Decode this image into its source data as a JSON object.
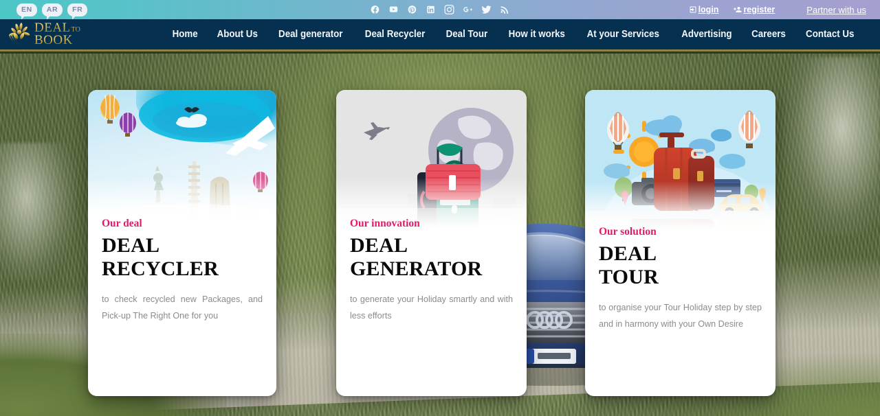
{
  "topbar": {
    "languages": [
      {
        "code": "EN",
        "name": "lang-en"
      },
      {
        "code": "AR",
        "name": "lang-ar"
      },
      {
        "code": "FR",
        "name": "lang-fr"
      }
    ],
    "social": [
      {
        "icon": "facebook-icon",
        "label": "Facebook"
      },
      {
        "icon": "youtube-icon",
        "label": "YouTube"
      },
      {
        "icon": "pinterest-icon",
        "label": "Pinterest"
      },
      {
        "icon": "linkedin-icon",
        "label": "LinkedIn"
      },
      {
        "icon": "instagram-icon",
        "label": "Instagram"
      },
      {
        "icon": "googleplus-icon",
        "label": "Google Plus"
      },
      {
        "icon": "twitter-icon",
        "label": "Twitter"
      },
      {
        "icon": "rss-icon",
        "label": "RSS"
      }
    ],
    "login_label": "login",
    "register_label": "register",
    "partner_label": "Partner with us"
  },
  "brand": {
    "line1": "DEAL",
    "line1_sup": "TO",
    "line2": "BOOK",
    "logo_icon": "lotus-flower-logo-icon"
  },
  "nav": {
    "items": [
      {
        "label": "Home",
        "name": "nav-item-home"
      },
      {
        "label": "About Us",
        "name": "nav-item-about-us"
      },
      {
        "label": "Deal generator",
        "name": "nav-item-deal-generator"
      },
      {
        "label": "Deal Recycler",
        "name": "nav-item-deal-recycler"
      },
      {
        "label": "Deal Tour",
        "name": "nav-item-deal-tour"
      },
      {
        "label": "How it works",
        "name": "nav-item-how-it-works"
      },
      {
        "label": "At your Services",
        "name": "nav-item-at-your-services"
      },
      {
        "label": "Advertising",
        "name": "nav-item-advertising"
      },
      {
        "label": "Careers",
        "name": "nav-item-careers"
      },
      {
        "label": "Contact Us",
        "name": "nav-item-contact-us"
      }
    ]
  },
  "hero": {
    "background_description": "green mossy mountain hillside with gravel road and blue SUV",
    "cards": [
      {
        "eyebrow": "Our deal",
        "title_line1": "DEAL",
        "title_line2": "RECYCLER",
        "description": "to check recycled new Packages, and Pick-up The Right One for you",
        "image": "travel-collage-balloons-airplane-landmarks"
      },
      {
        "eyebrow": "Our innovation",
        "title_line1": "DEAL",
        "title_line2": "GENERATOR",
        "description": "to generate your Holiday smartly and with less efforts",
        "image": "flat-illustration-suitcases-globe-airplane"
      },
      {
        "eyebrow": "Our solution",
        "title_line1": "DEAL",
        "title_line2": "TOUR",
        "description": "to organise your Tour Holiday step by step and in harmony with your Own Desire",
        "image": "cartoon-travel-scene-suitcases-balloons-sun"
      }
    ]
  },
  "colors": {
    "accent_pink": "#e8176b",
    "nav_navy": "#06304f",
    "nav_gold_rule": "#8d8249",
    "topbar_gradient_start": "#4cc6c6",
    "topbar_gradient_end": "#a59fcf"
  }
}
